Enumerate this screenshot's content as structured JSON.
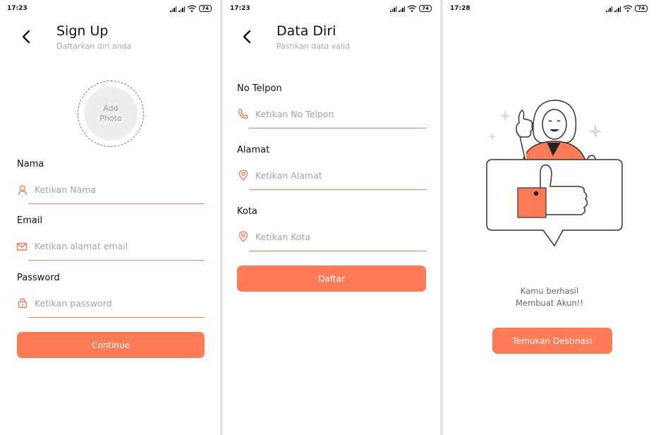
{
  "screens": {
    "signup": {
      "time": "17:23",
      "battery": "74",
      "title": "Sign Up",
      "subtitle": "Daftarkan diri anda",
      "photo": {
        "line1": "Add",
        "line2": "Photo"
      },
      "fields": [
        {
          "label": "Nama",
          "placeholder": "Ketikan Nama",
          "icon": "user-icon"
        },
        {
          "label": "Email",
          "placeholder": "Ketikan alamat email",
          "icon": "mail-icon"
        },
        {
          "label": "Password",
          "placeholder": "Ketikan password",
          "icon": "lock-icon"
        }
      ],
      "button": "Continue"
    },
    "datadiri": {
      "time": "17:23",
      "battery": "74",
      "title": "Data Diri",
      "subtitle": "Pastikan data valid",
      "fields": [
        {
          "label": "No Telpon",
          "placeholder": "Ketikan No Telpon",
          "icon": "phone-icon"
        },
        {
          "label": "Alamat",
          "placeholder": "Ketikan Alamat",
          "icon": "location-pin-icon"
        },
        {
          "label": "Kota",
          "placeholder": "Ketikan Kota",
          "icon": "location-pin-icon"
        }
      ],
      "button": "Daftar"
    },
    "success": {
      "time": "17:28",
      "battery": "74",
      "message_line1": "Kamu berhasil",
      "message_line2": "Membuat Akun!!",
      "button": "Temukan Destinasi"
    }
  },
  "colors": {
    "accent": "#ff7b57",
    "underline": "#ef8060",
    "placeholder": "#a2a2a2",
    "subtitle": "#a8a8a8"
  }
}
